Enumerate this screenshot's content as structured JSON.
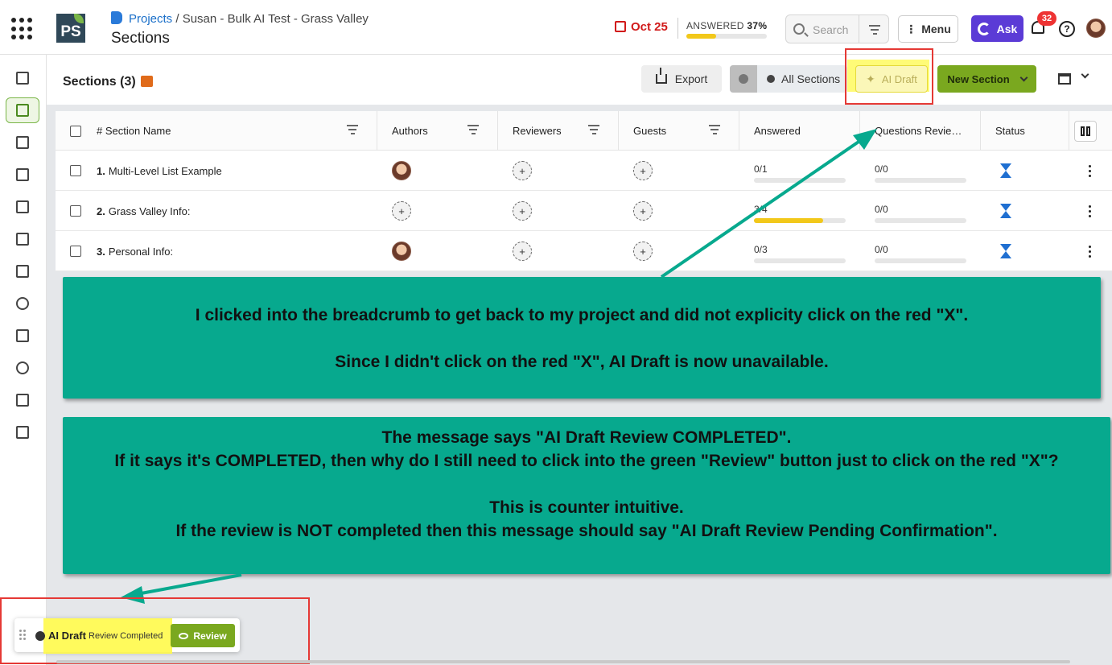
{
  "header": {
    "breadcrumb_link": "Projects",
    "breadcrumb_sep": " / ",
    "breadcrumb_project": "Susan - Bulk AI Test - Grass Valley",
    "page_title": "Sections",
    "due_date": "Oct 25",
    "answered_label": "ANSWERED",
    "answered_pct": "37%",
    "answered_fraction": 0.37,
    "search_placeholder": "Search",
    "menu_label": "Menu",
    "ask_label": "Ask",
    "notification_count": "32",
    "help_glyph": "?"
  },
  "icons": {
    "apps": "apps-grid-icon",
    "search": "search-icon",
    "filter": "filter-icon",
    "bell": "bell-icon",
    "help": "help-icon",
    "export": "upload-icon",
    "ai": "sparkle-icon",
    "status": "hourglass-icon"
  },
  "leftnav": [
    {
      "name": "briefcase"
    },
    {
      "name": "sections",
      "active": true
    },
    {
      "name": "notes"
    },
    {
      "name": "calendar"
    },
    {
      "name": "upload"
    },
    {
      "name": "dashboard"
    },
    {
      "name": "comments"
    },
    {
      "name": "users"
    },
    {
      "name": "documents"
    },
    {
      "name": "history"
    },
    {
      "name": "questions"
    },
    {
      "name": "clipboard"
    }
  ],
  "toolbar": {
    "title": "Sections (3)",
    "export_label": "Export",
    "all_sections_label": "All Sections",
    "ai_draft_label": "AI Draft",
    "new_section_label": "New Section"
  },
  "table": {
    "columns": [
      "# Section Name",
      "Authors",
      "Reviewers",
      "Guests",
      "Answered",
      "Questions Revie…",
      "Status"
    ],
    "rows": [
      {
        "num": "1.",
        "name": "Multi-Level List Example",
        "author_avatar": true,
        "answered": "0/1",
        "answered_frac": 0.0,
        "reviewed": "0/0"
      },
      {
        "num": "2.",
        "name": "Grass Valley Info:",
        "author_avatar": false,
        "answered": "3/4",
        "answered_frac": 0.75,
        "reviewed": "0/0"
      },
      {
        "num": "3.",
        "name": "Personal Info:",
        "author_avatar": true,
        "answered": "0/3",
        "answered_frac": 0.0,
        "reviewed": "0/0"
      }
    ],
    "add_glyph": "+"
  },
  "annotations": {
    "note1_line1": "I clicked into the breadcrumb to get back to my project and did not explicity click on the red \"X\".",
    "note1_line2": "Since I didn't click on the red \"X\", AI Draft is now unavailable.",
    "note2_line1": "The message says \"AI Draft Review COMPLETED\".",
    "note2_line2": "If it says it's COMPLETED, then why do I still need to click into the green \"Review\" button just to click on the red \"X\"?",
    "note2_line3": "This is counter intuitive.",
    "note2_line4": "If the review is NOT completed then this message should say \"AI Draft Review Pending Confirmation\"."
  },
  "toast": {
    "title": "AI Draft",
    "subtitle": "Review Completed",
    "review_label": "Review"
  },
  "colors": {
    "accent_green": "#7aa81f",
    "ask_purple": "#5b3bd6",
    "alert_red": "#e53935",
    "note_teal": "#07a98e",
    "highlight_yellow": "#fff94a"
  }
}
